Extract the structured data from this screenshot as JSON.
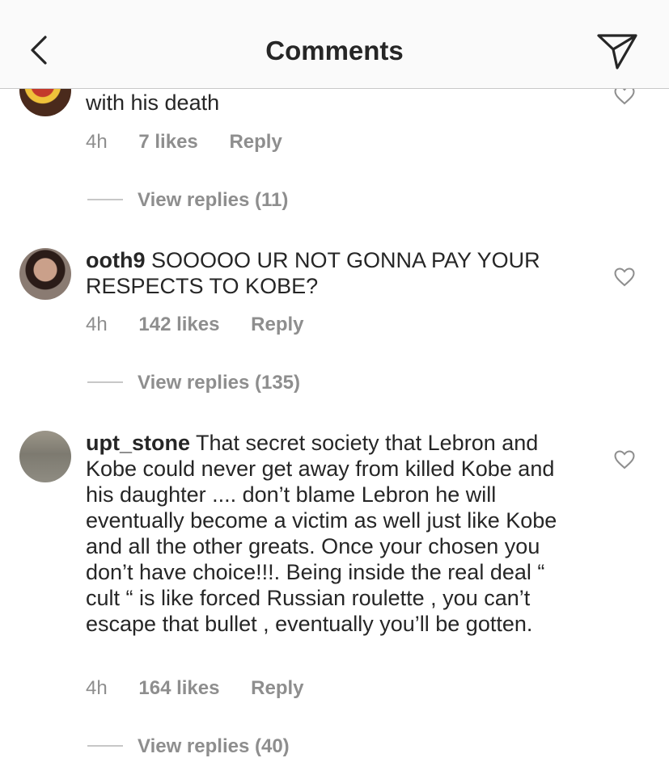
{
  "header": {
    "title": "Comments",
    "back_icon": "chevron-left-icon",
    "share_icon": "paper-plane-icon"
  },
  "comments": [
    {
      "username": "",
      "text": "with his death",
      "time": "4h",
      "likes": "7 likes",
      "reply": "Reply",
      "view_replies": "View replies (11)"
    },
    {
      "username": "ooth9",
      "text": " SOOOOO UR NOT GONNA PAY YOUR RESPECTS TO KOBE?",
      "time": "4h",
      "likes": "142 likes",
      "reply": "Reply",
      "view_replies": "View replies (135)"
    },
    {
      "username": "upt_stone",
      "text": " That secret society that Lebron and Kobe could never get away from killed Kobe and his daughter .... don’t blame Lebron he will eventually become a victim as well just like Kobe and all the other greats. Once your chosen you don’t have choice!!!. Being inside the real deal “ cult “  is like forced Russian roulette , you can’t escape that bullet , eventually you’ll be gotten.",
      "time": "4h",
      "likes": "164 likes",
      "reply": "Reply",
      "view_replies": "View replies (40)"
    }
  ],
  "colors": {
    "text": "#262626",
    "muted": "#8e8e8e",
    "header_bg": "#fafafa"
  }
}
